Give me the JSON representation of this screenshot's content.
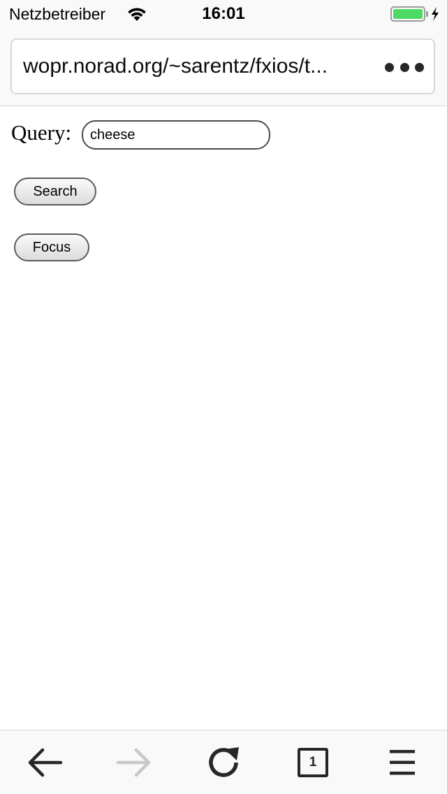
{
  "status_bar": {
    "carrier": "Netzbetreiber",
    "time": "16:01",
    "battery_color": "#4cd964",
    "icons": [
      "wifi-icon",
      "battery-icon",
      "charging-bolt-icon"
    ]
  },
  "url_bar": {
    "url": "wopr.norad.org/~sarentz/fxios/t...",
    "more_icon": "more-dots-icon"
  },
  "page": {
    "query_label": "Query:",
    "query_value": "cheese",
    "search_label": "Search",
    "focus_label": "Focus"
  },
  "toolbar": {
    "tab_count": "1",
    "icons": [
      "back-arrow-icon",
      "forward-arrow-icon",
      "reload-icon",
      "tabs-icon",
      "menu-icon"
    ],
    "disabled_color": "#c8c8c8",
    "active_color": "#272727"
  }
}
